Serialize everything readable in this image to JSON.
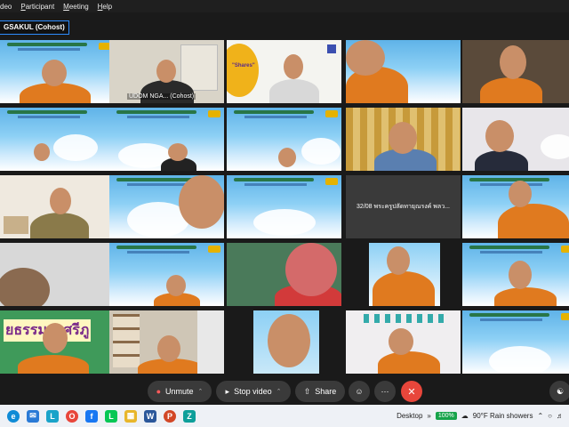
{
  "menu": [
    "deo",
    "Participant",
    "Meeting",
    "Help"
  ],
  "host_name": "GSAKUL (Cohost)",
  "tiles": [
    {
      "kind": "monk-slide"
    },
    {
      "kind": "person-office",
      "label": "UDOM NGA... (Cohost)"
    },
    {
      "kind": "person-poster",
      "poster_title": "\"Shares\""
    },
    {
      "kind": "monk-closeup"
    },
    {
      "kind": "monk-room"
    },
    {
      "kind": "monk-slide-small"
    },
    {
      "kind": "person-slide"
    },
    {
      "kind": "monk-slide-small2"
    },
    {
      "kind": "person-curtain"
    },
    {
      "kind": "woman-glasses"
    },
    {
      "kind": "officer-room"
    },
    {
      "kind": "monk-slide-big"
    },
    {
      "kind": "slide-only"
    },
    {
      "kind": "name-only",
      "label": "32/08 พระครูปลัดทายุณรงค์ พลว..."
    },
    {
      "kind": "monk-slide-right"
    },
    {
      "kind": "monk-dark"
    },
    {
      "kind": "monk-slide-low"
    },
    {
      "kind": "monk-pink-face"
    },
    {
      "kind": "monk-standing"
    },
    {
      "kind": "monk-slide-right2"
    },
    {
      "kind": "banner-monk",
      "banner": "ยธรรม ญศรีภู"
    },
    {
      "kind": "monk-shelves"
    },
    {
      "kind": "monk-phone"
    },
    {
      "kind": "monk-classroom"
    },
    {
      "kind": "slide-only2"
    }
  ],
  "toolbar": {
    "unmute": "Unmute",
    "stop_video": "Stop video",
    "share": "Share"
  },
  "taskbar": {
    "desktop": "Desktop",
    "battery": "100%",
    "weather": "90°F  Rain showers"
  },
  "colors": {
    "accent": "#2d8cff",
    "end": "#e8463b",
    "robe": "#e07a1f"
  }
}
